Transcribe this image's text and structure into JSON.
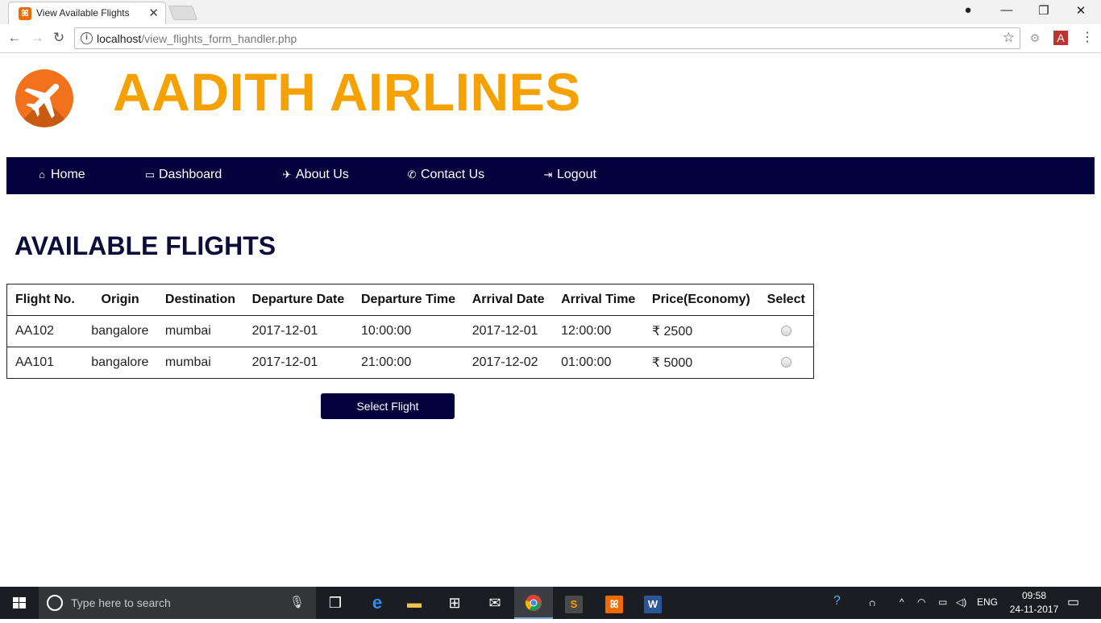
{
  "browser": {
    "tab_title": "View Available Flights",
    "url_host": "localhost",
    "url_path": "/view_flights_form_handler.php"
  },
  "site": {
    "brand": "AADITH AIRLINES",
    "brand_color": "#f5a100",
    "nav_color": "#02023d",
    "nav": [
      {
        "label": "Home",
        "icon": "home-icon"
      },
      {
        "label": "Dashboard",
        "icon": "monitor-icon"
      },
      {
        "label": "About Us",
        "icon": "plane-icon"
      },
      {
        "label": "Contact Us",
        "icon": "phone-icon"
      },
      {
        "label": "Logout",
        "icon": "logout-icon"
      }
    ]
  },
  "page": {
    "heading": "AVAILABLE FLIGHTS",
    "select_button": "Select Flight"
  },
  "table": {
    "headers": [
      "Flight No.",
      "Origin",
      "Destination",
      "Departure Date",
      "Departure Time",
      "Arrival Date",
      "Arrival Time",
      "Price(Economy)",
      "Select"
    ],
    "rows": [
      {
        "flight": "AA102",
        "origin": "bangalore",
        "destination": "mumbai",
        "dep_date": "2017-12-01",
        "dep_time": "10:00:00",
        "arr_date": "2017-12-01",
        "arr_time": "12:00:00",
        "price": "₹ 2500"
      },
      {
        "flight": "AA101",
        "origin": "bangalore",
        "destination": "mumbai",
        "dep_date": "2017-12-01",
        "dep_time": "21:00:00",
        "arr_date": "2017-12-02",
        "arr_time": "01:00:00",
        "price": "₹ 5000"
      }
    ]
  },
  "taskbar": {
    "search_placeholder": "Type here to search",
    "language": "ENG",
    "time": "09:58",
    "date": "24-11-2017"
  }
}
